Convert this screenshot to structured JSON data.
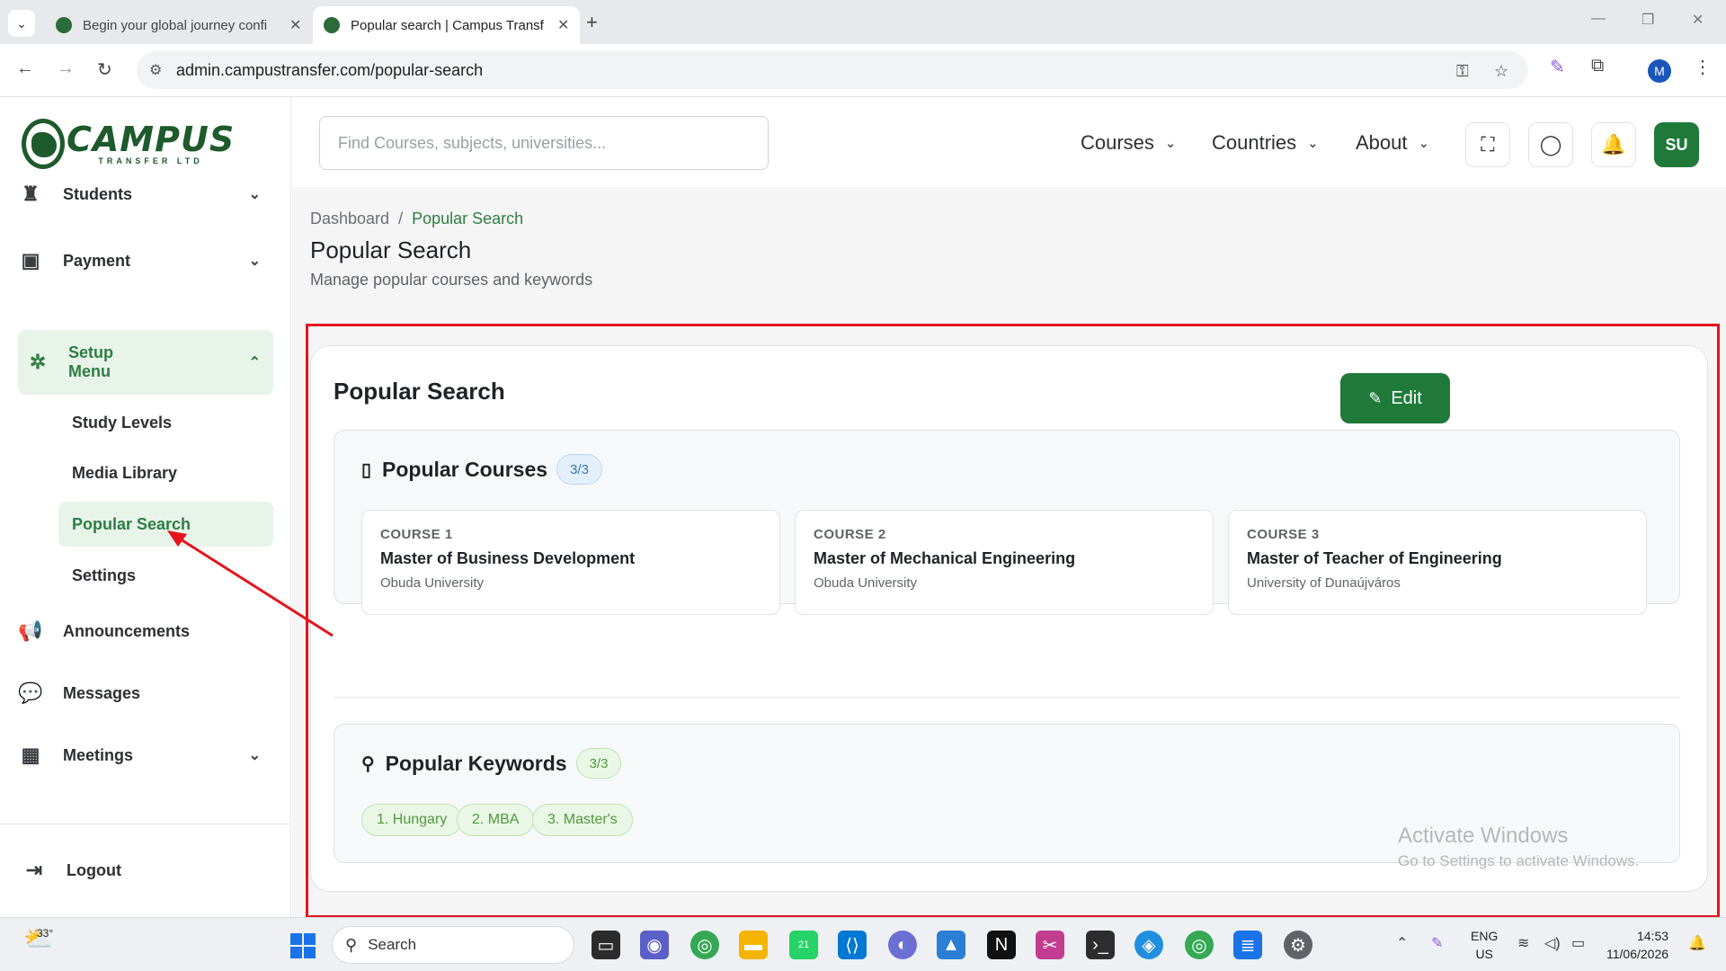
{
  "browser": {
    "tabs": [
      {
        "title": "Begin your global journey confi"
      },
      {
        "title": "Popular search | Campus Transf"
      }
    ],
    "url": "admin.campustransfer.com/popular-search"
  },
  "logo": {
    "word": "CAMPUS",
    "sub": "TRANSFER LTD"
  },
  "sidebar": {
    "items": [
      {
        "label": "Students",
        "icon": "student-icon"
      },
      {
        "label": "Payment",
        "icon": "payment-icon"
      },
      {
        "label": "Setup Menu",
        "icon": "gear-icon"
      },
      {
        "label": "Announcements",
        "icon": "megaphone-icon"
      },
      {
        "label": "Messages",
        "icon": "chat-icon"
      },
      {
        "label": "Meetings",
        "icon": "calendar-icon"
      }
    ],
    "setup_sub": [
      "Study Levels",
      "Media Library",
      "Popular Search",
      "Settings"
    ],
    "logout": "Logout"
  },
  "header": {
    "search_placeholder": "Find Courses, subjects, universities...",
    "nav": [
      "Courses",
      "Countries",
      "About"
    ],
    "avatar_initials": "SU"
  },
  "page": {
    "breadcrumb": [
      "Dashboard",
      "Popular Search"
    ],
    "title": "Popular Search",
    "subtitle": "Manage popular courses and keywords"
  },
  "card": {
    "title": "Popular Search",
    "edit_label": "Edit",
    "courses_heading": "Popular Courses",
    "courses_count": "3/3",
    "courses": [
      {
        "num": "COURSE 1",
        "name": "Master of Business Development",
        "university": "Obuda University"
      },
      {
        "num": "COURSE 2",
        "name": "Master of Mechanical Engineering",
        "university": "Obuda University"
      },
      {
        "num": "COURSE 3",
        "name": "Master of Teacher of Engineering",
        "university": "University of Dunaújváros"
      }
    ],
    "keywords_heading": "Popular Keywords",
    "keywords_count": "3/3",
    "keywords": [
      "1. Hungary",
      "2. MBA",
      "3. Master's"
    ]
  },
  "watermark": {
    "line1": "Activate Windows",
    "line2": "Go to Settings to activate Windows."
  },
  "taskbar": {
    "temp": "33°",
    "search": "Search",
    "lang": "ENG",
    "region": "US",
    "time": "14:53",
    "date": "11/06/2026",
    "whatsapp_badge": "21"
  },
  "colors": {
    "brand_green": "#1f7a3a",
    "active_bg": "#e8f3ea",
    "highlight_red": "#e5141c"
  }
}
